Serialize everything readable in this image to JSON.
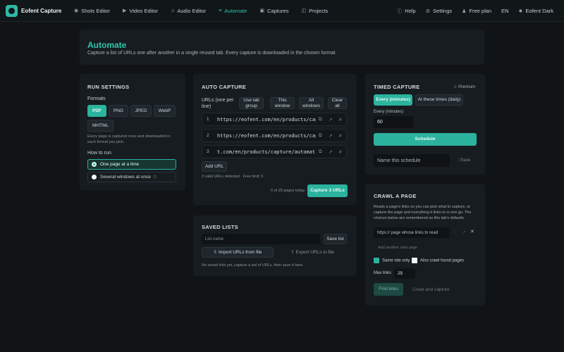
{
  "app": {
    "name": "Eofent Capture"
  },
  "nav": {
    "items": [
      {
        "label": "Shots Editor",
        "icon": "camera-icon"
      },
      {
        "label": "Video Editor",
        "icon": "video-icon"
      },
      {
        "label": "Audio Editor",
        "icon": "audio-icon"
      },
      {
        "label": "Automate",
        "icon": "automate-icon",
        "active": true
      },
      {
        "label": "Captures",
        "icon": "captures-icon"
      },
      {
        "label": "Projects",
        "icon": "projects-icon"
      }
    ],
    "help": "Help",
    "settings": "Settings",
    "plan": "Free plan",
    "lang": "EN",
    "theme": "Eofent Dark"
  },
  "header": {
    "title": "Automate",
    "subtitle": "Capture a list of URLs one after another in a single reused tab. Every capture is downloaded in the chosen format."
  },
  "run_settings": {
    "title": "RUN SETTINGS",
    "formats_label": "Formats",
    "formats": [
      "PDF",
      "PNG",
      "JPEG",
      "WebP",
      "MHTML"
    ],
    "selected_format": "PDF",
    "formats_help": "Every page is captured once and downloaded in each format you pick.",
    "how_label": "How to run",
    "options": [
      "One page at a time",
      "Several windows at once"
    ]
  },
  "auto_capture": {
    "title": "AUTO CAPTURE",
    "urls_label": "URLs (one per line)",
    "buttons": [
      "Use tab group",
      "This window",
      "All windows",
      "Clear all"
    ],
    "urls": [
      {
        "num": "1",
        "url": "https://eofent.com/en/products/capture"
      },
      {
        "num": "2",
        "url": "https://eofent.com/en/products/capture"
      },
      {
        "num": "3",
        "url": "t.com/en/products/capture/automation"
      }
    ],
    "add_url": "Add URL",
    "detected": "3 valid URLs detected · Free limit: 5",
    "pages_today": "0 of 25 pages today",
    "capture_button": "Capture 3 URLs"
  },
  "saved_lists": {
    "title": "SAVED LISTS",
    "placeholder": "List name",
    "save_list": "Save list",
    "import": "Import URLs from file",
    "export": "Export URLs to file",
    "empty": "No saved lists yet, capture a set of URLs, then save it here."
  },
  "timed_capture": {
    "title": "TIMED CAPTURE",
    "premium": "Premium",
    "modes": [
      "Every (minutes)",
      "At these times (daily)"
    ],
    "every_label": "Every (minutes)",
    "every_value": "60",
    "schedule": "Schedule",
    "name_placeholder": "Name this schedule",
    "save": "Save"
  },
  "crawl": {
    "title": "CRAWL A PAGE",
    "desc": "Reads a page's links so you can pick what to capture, or capture the page and everything it links to in one go. The choices below are remembered as this tab's defaults.",
    "url_placeholder": "https:// page whose links to read",
    "add_start": "Add another start page",
    "same_site": "Same site only",
    "also_crawl": "Also crawl found pages",
    "max_links_label": "Max links",
    "max_links_value": "25",
    "find_links": "Find links",
    "crawl_capture": "Crawl and capture"
  },
  "colors": {
    "accent": "#2fc4ad",
    "background": "#101417",
    "card": "#161c20"
  }
}
